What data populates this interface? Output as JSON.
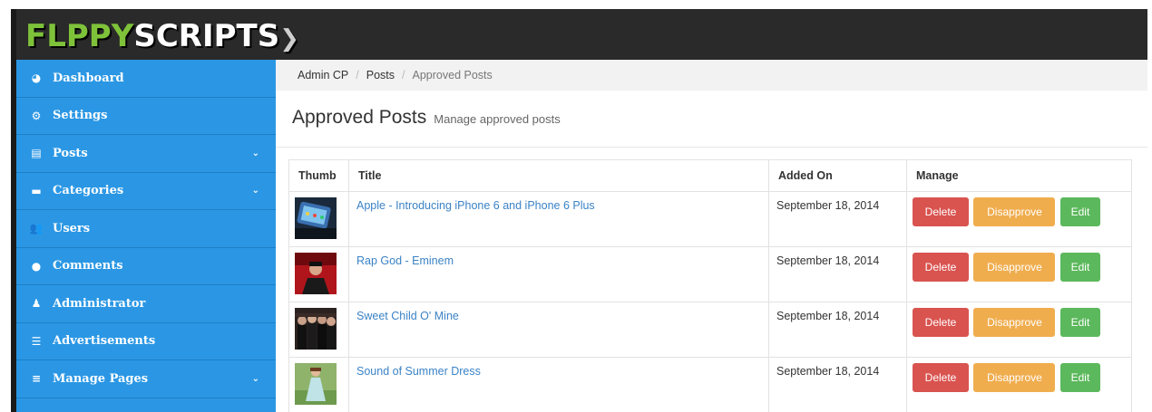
{
  "brand": {
    "part1": "FLPPY",
    "part2": "SCRIPTS",
    "accent": "#7ec23a"
  },
  "sidebar": {
    "items": [
      {
        "label": "Dashboard",
        "icon": "dashboard-icon",
        "glyph": "◕",
        "has_submenu": false
      },
      {
        "label": "Settings",
        "icon": "cogs-icon",
        "glyph": "⚙",
        "has_submenu": false
      },
      {
        "label": "Posts",
        "icon": "file-icon",
        "glyph": "▤",
        "has_submenu": true
      },
      {
        "label": "Categories",
        "icon": "list-bars-icon",
        "glyph": "▬",
        "has_submenu": true
      },
      {
        "label": "Users",
        "icon": "users-icon",
        "glyph": "👥",
        "has_submenu": false
      },
      {
        "label": "Comments",
        "icon": "comments-icon",
        "glyph": "●",
        "has_submenu": false
      },
      {
        "label": "Administrator",
        "icon": "user-icon",
        "glyph": "♟",
        "has_submenu": false
      },
      {
        "label": "Advertisements",
        "icon": "list-alt-icon",
        "glyph": "☰",
        "has_submenu": false
      },
      {
        "label": "Manage Pages",
        "icon": "align-left-icon",
        "glyph": "≡",
        "has_submenu": true
      }
    ],
    "chevron_glyph": "⌄",
    "color": "#2b97e4"
  },
  "breadcrumb": {
    "items": [
      "Admin CP",
      "Posts",
      "Approved Posts"
    ],
    "separator": "/"
  },
  "page": {
    "title": "Approved Posts",
    "subtitle": "Manage approved posts"
  },
  "table": {
    "headers": {
      "thumb": "Thumb",
      "title": "Title",
      "added_on": "Added On",
      "manage": "Manage"
    },
    "actions": {
      "delete": "Delete",
      "disapprove": "Disapprove",
      "edit": "Edit"
    },
    "rows": [
      {
        "title": "Apple - Introducing iPhone 6 and iPhone 6 Plus",
        "added_on": "September 18, 2014",
        "thumb": "iphone-thumbnail"
      },
      {
        "title": "Rap God - Eminem",
        "added_on": "September 18, 2014",
        "thumb": "eminem-thumbnail"
      },
      {
        "title": "Sweet Child O' Mine",
        "added_on": "September 18, 2014",
        "thumb": "band-thumbnail"
      },
      {
        "title": "Sound of Summer Dress",
        "added_on": "September 18, 2014",
        "thumb": "dress-thumbnail"
      }
    ]
  },
  "colors": {
    "delete": "#d9534f",
    "disapprove": "#f0ad4e",
    "edit": "#5cb85c",
    "link": "#3b83c6"
  }
}
